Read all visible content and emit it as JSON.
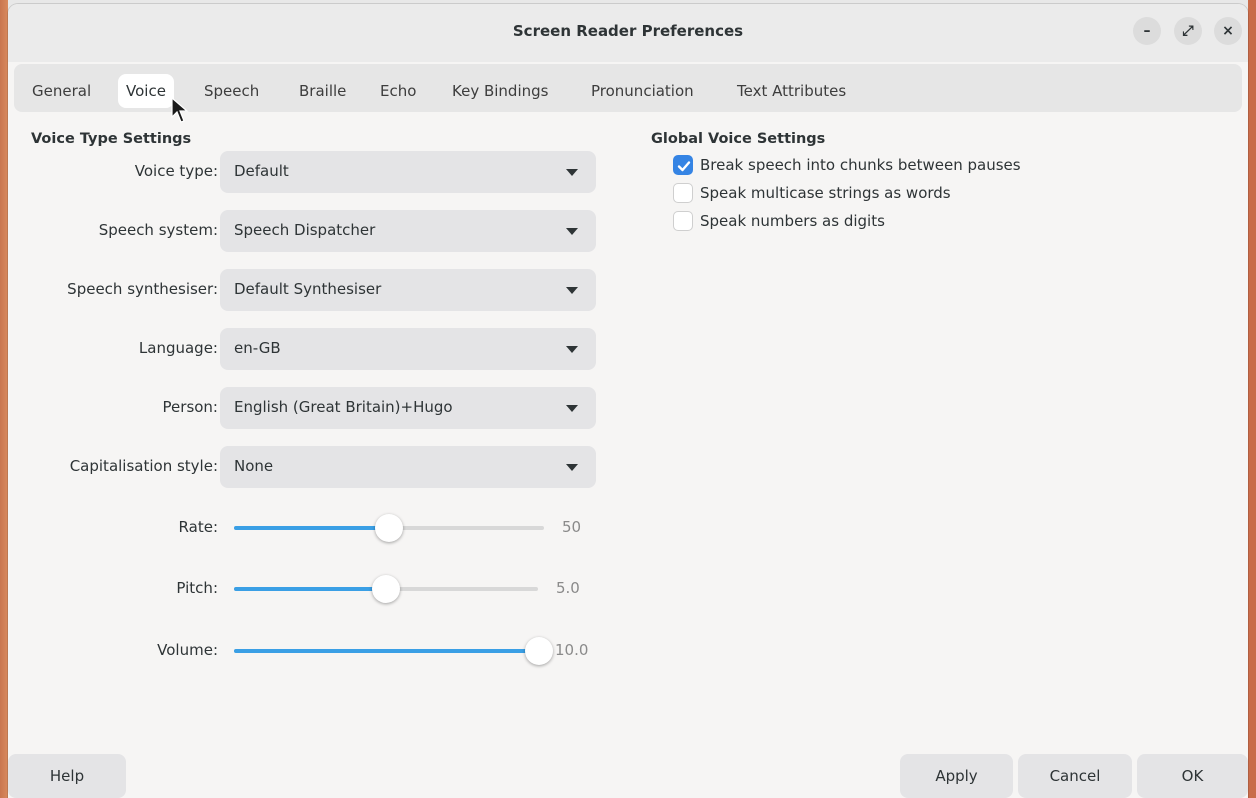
{
  "window": {
    "title": "Screen Reader Preferences",
    "controls": {
      "minimize": "–",
      "maximize": "⤢",
      "close": "×"
    }
  },
  "tabs": [
    "General",
    "Voice",
    "Speech",
    "Braille",
    "Echo",
    "Key Bindings",
    "Pronunciation",
    "Text Attributes"
  ],
  "active_tab": "Voice",
  "voice_type_settings": {
    "title": "Voice Type Settings",
    "rows": [
      {
        "label": "Voice type:",
        "value": "Default"
      },
      {
        "label": "Speech system:",
        "value": "Speech Dispatcher"
      },
      {
        "label": "Speech synthesiser:",
        "value": "Default Synthesiser"
      },
      {
        "label": "Language:",
        "value": "en-GB"
      },
      {
        "label": "Person:",
        "value": "English (Great Britain)+Hugo"
      },
      {
        "label": "Capitalisation style:",
        "value": "None"
      }
    ],
    "sliders": [
      {
        "label": "Rate:",
        "value_text": "50",
        "fraction": 0.5
      },
      {
        "label": "Pitch:",
        "value_text": "5.0",
        "fraction": 0.5
      },
      {
        "label": "Volume:",
        "value_text": "10.0",
        "fraction": 1.0
      }
    ]
  },
  "global_voice_settings": {
    "title": "Global Voice Settings",
    "checks": [
      {
        "label": "Break speech into chunks between pauses",
        "checked": true
      },
      {
        "label": "Speak multicase strings as words",
        "checked": false
      },
      {
        "label": "Speak numbers as digits",
        "checked": false
      }
    ]
  },
  "buttons": {
    "help": "Help",
    "apply": "Apply",
    "cancel": "Cancel",
    "ok": "OK"
  },
  "colors": {
    "accent": "#3584e4",
    "slider_fill": "#3a9fe5"
  }
}
